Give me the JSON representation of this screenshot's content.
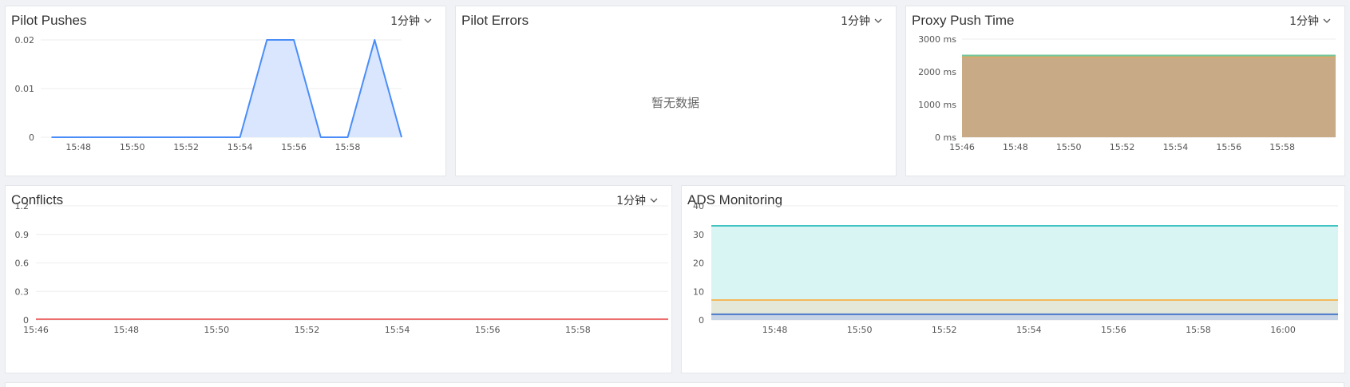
{
  "panels": {
    "pilot_pushes": {
      "title": "Pilot Pushes",
      "interval": "1分钟"
    },
    "pilot_errors": {
      "title": "Pilot Errors",
      "interval": "1分钟",
      "empty_text": "暂无数据"
    },
    "proxy_push_time": {
      "title": "Proxy Push Time",
      "interval": "1分钟"
    },
    "conflicts": {
      "title": "Conflicts",
      "interval": "1分钟"
    },
    "ads_monitoring": {
      "title": "ADS Monitoring"
    }
  },
  "icons": {
    "interval_dropdown": "chevron-down-icon"
  },
  "colors": {
    "blue_line": "#4a8df8",
    "blue_fill": "#d9e6fd",
    "proxy_green": "#74c69d",
    "proxy_fill": "#c9aa86",
    "conflict_red": "#ec6e6e",
    "ads_teal": "#40c3c2",
    "ads_teal_fill": "#d8f4f3",
    "ads_orange": "#f5b95b",
    "ads_orange_fill": "#e3e8d9",
    "ads_blue": "#4b78c8",
    "ads_blue_fill": "#c6d4e5"
  },
  "chart_data": [
    {
      "id": "pilot_pushes",
      "type": "area",
      "x": [
        "15:47",
        "15:48",
        "15:49",
        "15:50",
        "15:51",
        "15:52",
        "15:53",
        "15:54",
        "15:55",
        "15:56",
        "15:57",
        "15:58",
        "15:59",
        "16:00"
      ],
      "series": [
        {
          "values": [
            0,
            0,
            0,
            0,
            0,
            0,
            0,
            0,
            0.02,
            0.02,
            0,
            0,
            0.02,
            0
          ]
        }
      ],
      "x_ticks": [
        "15:48",
        "15:50",
        "15:52",
        "15:54",
        "15:56",
        "15:58"
      ],
      "y_ticks": [
        0,
        0.01,
        0.02
      ],
      "y_tick_labels": [
        "0",
        "0.01",
        "0.02"
      ],
      "ylim": [
        0,
        0.02
      ]
    },
    {
      "id": "proxy_push_time",
      "type": "area",
      "x": [
        "15:46",
        "16:00"
      ],
      "series": [
        {
          "values": [
            2500,
            2500
          ]
        },
        {
          "values": [
            2450,
            2450
          ]
        }
      ],
      "x_ticks": [
        "15:46",
        "15:48",
        "15:50",
        "15:52",
        "15:54",
        "15:56",
        "15:58"
      ],
      "y_ticks": [
        0,
        1000,
        2000,
        3000
      ],
      "y_tick_labels": [
        "0 ms",
        "1000 ms",
        "2000 ms",
        "3000 ms"
      ],
      "ylim": [
        0,
        3000
      ]
    },
    {
      "id": "conflicts",
      "type": "line",
      "x": [
        "15:46",
        "16:00"
      ],
      "series": [
        {
          "values": [
            0,
            0
          ]
        }
      ],
      "x_ticks": [
        "15:46",
        "15:48",
        "15:50",
        "15:52",
        "15:54",
        "15:56",
        "15:58"
      ],
      "y_ticks": [
        0,
        0.3,
        0.6,
        0.9,
        1.2
      ],
      "y_tick_labels": [
        "0",
        "0.3",
        "0.6",
        "0.9",
        "1.2"
      ],
      "ylim": [
        0,
        1.2
      ]
    },
    {
      "id": "ads_monitoring",
      "type": "area",
      "x": [
        "15:46.5",
        "16:01.3"
      ],
      "series": [
        {
          "values": [
            33,
            33
          ]
        },
        {
          "values": [
            7,
            7
          ]
        },
        {
          "values": [
            2,
            2
          ]
        }
      ],
      "x_ticks": [
        "15:48",
        "15:50",
        "15:52",
        "15:54",
        "15:56",
        "15:58",
        "16:00"
      ],
      "y_ticks": [
        0,
        10,
        20,
        30,
        40
      ],
      "y_tick_labels": [
        "0",
        "10",
        "20",
        "30",
        "40"
      ],
      "ylim": [
        0,
        40
      ]
    }
  ]
}
